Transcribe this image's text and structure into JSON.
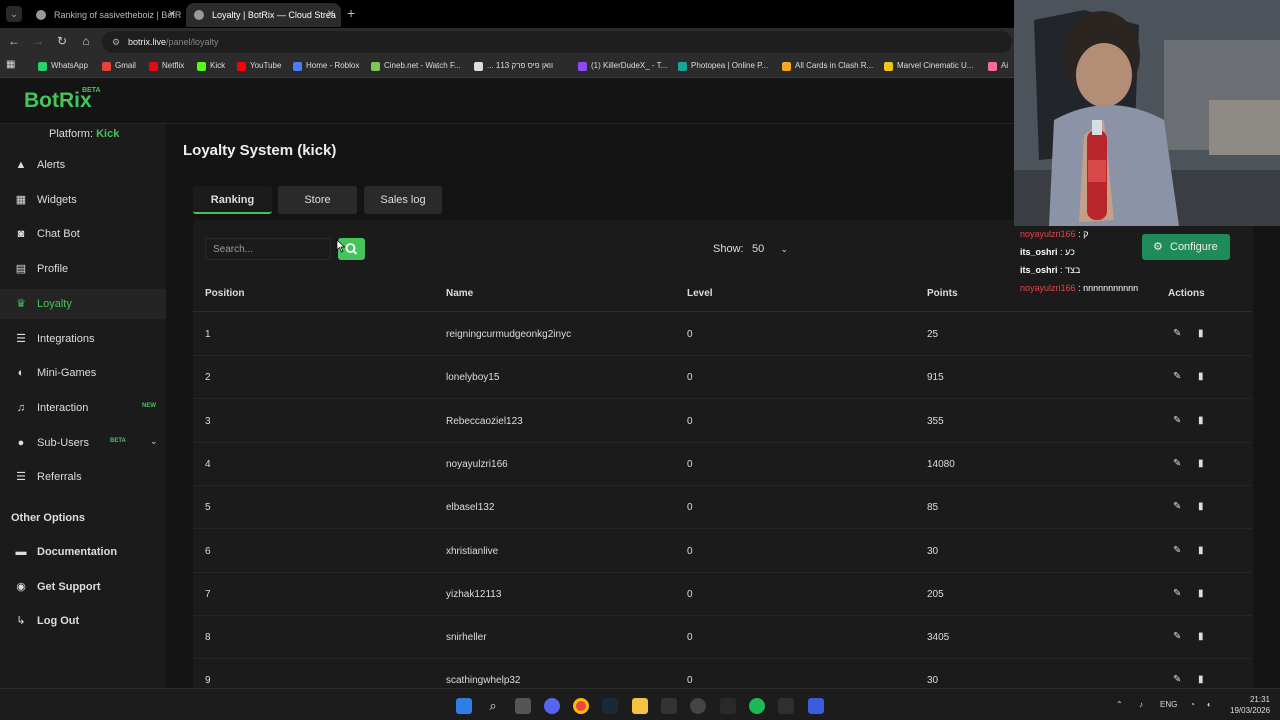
{
  "browser": {
    "tabs": [
      {
        "title": "Ranking of sasivetheboiz | BotR",
        "active": false
      },
      {
        "title": "Loyalty | BotRix — Cloud Strea",
        "active": true
      }
    ],
    "url": {
      "host": "botrix.live",
      "path": "/panel/loyalty"
    },
    "bookmarks": [
      {
        "label": "WhatsApp",
        "color": "#25d366"
      },
      {
        "label": "Gmail",
        "color": "#ea4335"
      },
      {
        "label": "Netflix",
        "color": "#e50914"
      },
      {
        "label": "Kick",
        "color": "#53fc18"
      },
      {
        "label": "YouTube",
        "color": "#ff0000"
      },
      {
        "label": "Home - Roblox",
        "color": "#4a7cff"
      },
      {
        "label": "Cineb.net - Watch F...",
        "color": "#7ec850"
      },
      {
        "label": "... וואן פיס פרק 113",
        "color": "#dddddd"
      },
      {
        "label": "(1) KillerDudeX_ - T...",
        "color": "#9146ff"
      },
      {
        "label": "Photopea | Online P...",
        "color": "#18a497"
      },
      {
        "label": "All Cards in Clash R...",
        "color": "#f5a623"
      },
      {
        "label": "Marvel Cinematic U...",
        "color": "#f0c419"
      },
      {
        "label": "Ai",
        "color": "#ff6b9a"
      }
    ]
  },
  "app": {
    "logo": "BotRix",
    "logo_badge": "BETA",
    "platform_label": "Platform:",
    "platform_value": "Kick",
    "nav": [
      {
        "label": "Alerts",
        "icon": "warning-icon",
        "glyph": "▲"
      },
      {
        "label": "Widgets",
        "icon": "widgets-icon",
        "glyph": "▦"
      },
      {
        "label": "Chat Bot",
        "icon": "robot-icon",
        "glyph": "◙"
      },
      {
        "label": "Profile",
        "icon": "profile-icon",
        "glyph": "▤"
      },
      {
        "label": "Loyalty",
        "icon": "trophy-icon",
        "glyph": "♛",
        "active": true
      },
      {
        "label": "Integrations",
        "icon": "list-icon",
        "glyph": "☰"
      },
      {
        "label": "Mini-Games",
        "icon": "gamepad-icon",
        "glyph": "◐"
      },
      {
        "label": "Interaction",
        "icon": "music-icon",
        "glyph": "♫",
        "badge": "NEW"
      },
      {
        "label": "Sub-Users",
        "icon": "users-icon",
        "glyph": "●",
        "badge": "BETA"
      },
      {
        "label": "Referrals",
        "icon": "referrals-icon",
        "glyph": "☰"
      }
    ],
    "other_options_heading": "Other Options",
    "other_nav": [
      {
        "label": "Documentation",
        "icon": "book-icon",
        "glyph": "▬"
      },
      {
        "label": "Get Support",
        "icon": "support-icon",
        "glyph": "◉"
      },
      {
        "label": "Log Out",
        "icon": "logout-icon",
        "glyph": "↳"
      }
    ]
  },
  "main": {
    "title": "Loyalty System (kick)",
    "tabs": [
      "Ranking",
      "Store",
      "Sales log"
    ],
    "active_tab": "Ranking",
    "search_placeholder": "Search...",
    "show_label": "Show:",
    "show_value": "50",
    "configure_label": "Configure",
    "columns": [
      "Position",
      "Name",
      "Level",
      "Points",
      "Actions"
    ],
    "rows": [
      {
        "position": "1",
        "name": "reigningcurmudgeonkg2inyc",
        "level": "0",
        "points": "25"
      },
      {
        "position": "2",
        "name": "lonelyboy15",
        "level": "0",
        "points": "915"
      },
      {
        "position": "3",
        "name": "Rebeccaoziel123",
        "level": "0",
        "points": "355"
      },
      {
        "position": "4",
        "name": "noyayulzri166",
        "level": "0",
        "points": "14080"
      },
      {
        "position": "5",
        "name": "elbasel132",
        "level": "0",
        "points": "85"
      },
      {
        "position": "6",
        "name": "xhristianlive",
        "level": "0",
        "points": "30"
      },
      {
        "position": "7",
        "name": "yizhak12113",
        "level": "0",
        "points": "205"
      },
      {
        "position": "8",
        "name": "snirheller",
        "level": "0",
        "points": "3405"
      },
      {
        "position": "9",
        "name": "scathingwhelp32",
        "level": "0",
        "points": "30"
      }
    ]
  },
  "chat_overlay": [
    {
      "user": "noyayulzri166",
      "text": ": ק"
    },
    {
      "user": "its_oshri",
      "text": ": כע"
    },
    {
      "user": "its_oshri",
      "text": ": בצד"
    },
    {
      "user": "noyayulzri166",
      "text": ": nnnnnnnnnnn"
    }
  ],
  "taskbar": {
    "lang": "ENG",
    "time": "21:31",
    "date": "19/03/2026"
  }
}
